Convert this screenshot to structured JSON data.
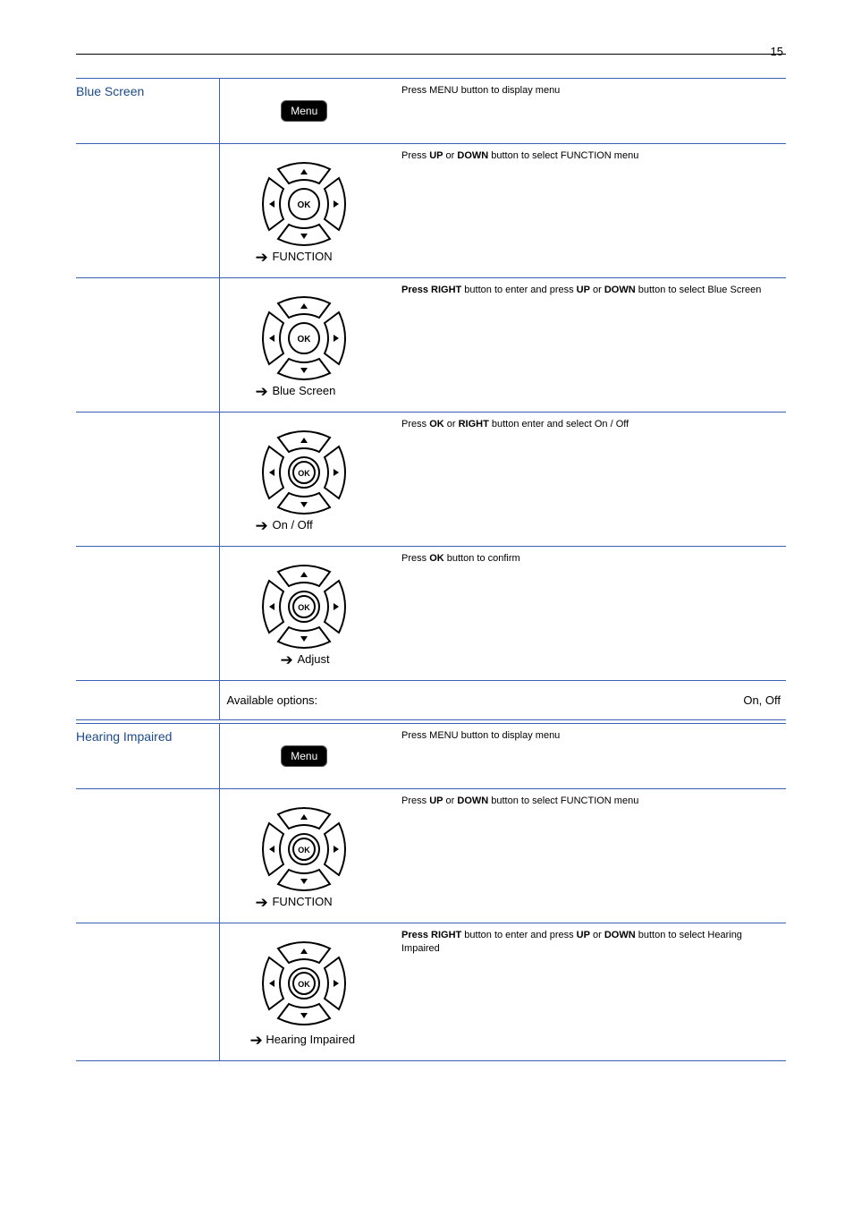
{
  "page_number": "15",
  "menu_label": "Menu",
  "ok_label": "OK",
  "arrow_brackets_left": "<",
  "arrow_brackets_right": ">",
  "arrow_right_glyph": "➔",
  "group1": {
    "title": "Blue Screen",
    "rows": {
      "r1": {
        "action": "",
        "text": "Press MENU button to display menu"
      },
      "r2": {
        "action": "FUNCTION",
        "text_before": "Press ",
        "text_bold": "UP",
        "text_mid": " or ",
        "text_bold2": "DOWN",
        "text_after": " button to select FUNCTION menu"
      },
      "r3": {
        "action": "Blue Screen",
        "text_bold_lead": "Press RIGHT",
        "text_mid": " button to enter and press ",
        "text_bold_mid": "UP",
        "text_or": " or ",
        "text_bold_mid2": "DOWN",
        "text_after": " button to select Blue Screen"
      },
      "r4": {
        "action": "On / Off",
        "text_before": "Press ",
        "text_bold": "OK",
        "text_mid": " or ",
        "text_bold2": "RIGHT",
        "text_after": " button enter and select On / Off"
      },
      "r5": {
        "action": "Adjust",
        "text_before": "Press ",
        "text_bold": "OK",
        "text_after": " button to confirm"
      },
      "footer_left": "Available options:",
      "footer_right": "On, Off"
    }
  },
  "group2": {
    "title": "Hearing Impaired",
    "rows": {
      "r1": {
        "action": "",
        "text": "Press MENU button to display menu"
      },
      "r2": {
        "action": "FUNCTION",
        "text_before": "Press ",
        "text_bold": "UP",
        "text_mid": " or ",
        "text_bold2": "DOWN",
        "text_after": " button to select FUNCTION menu"
      },
      "r3": {
        "action": "Hearing Impaired",
        "text_bold_lead": "Press RIGHT",
        "text_mid": " button to enter and press ",
        "text_bold_mid": "UP",
        "text_or": " or ",
        "text_bold_mid2": "DOWN",
        "text_after": " button to select Hearing Impaired"
      }
    }
  }
}
